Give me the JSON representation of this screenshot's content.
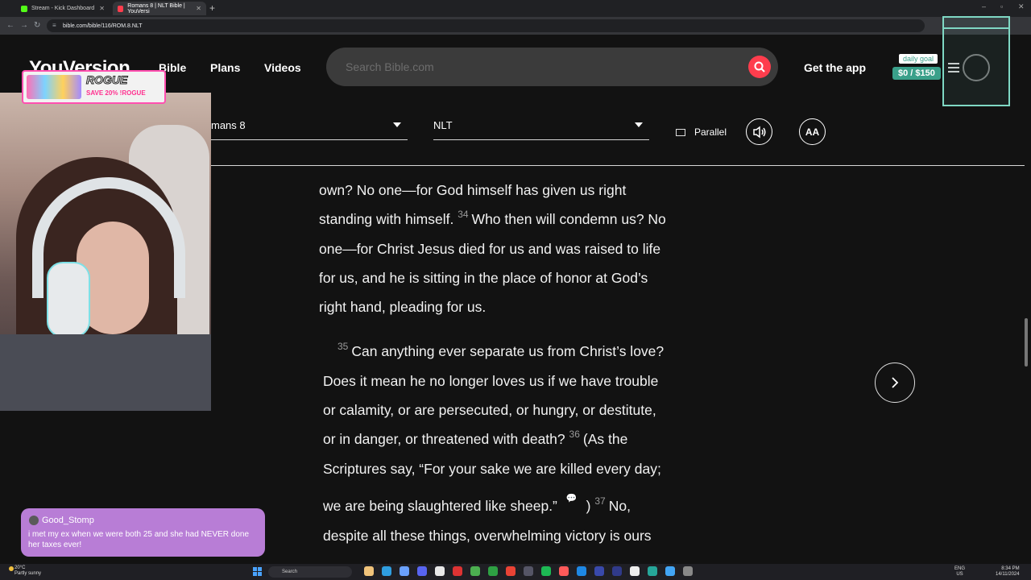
{
  "browser": {
    "tabs": [
      {
        "title": "Stream - Kick Dashboard",
        "color": "#53fc18"
      },
      {
        "title": "Romans 8 | NLT Bible | YouVersi",
        "color": "#ff3d4d"
      }
    ],
    "new_tab": "+",
    "url": "bible.com/bible/116/ROM.8.NLT"
  },
  "site": {
    "logo": "YouVersion",
    "nav": [
      "Bible",
      "Plans",
      "Videos"
    ],
    "search_placeholder": "Search Bible.com",
    "get_app": "Get the app",
    "accent": "#ff3d4d"
  },
  "toolbar": {
    "book_chapter": "mans 8",
    "version": "NLT",
    "parallel": "Parallel",
    "font_button": "AA"
  },
  "scripture": {
    "lines": [
      {
        "text": "own? No one—for God himself has given us right"
      },
      {
        "pre": "standing with himself.",
        "num": "34",
        "post": "Who then will condemn us? No"
      },
      {
        "text": "one—for Christ Jesus died for us and was raised to life"
      },
      {
        "text": "for us, and he is sitting in the place of honor at God’s"
      },
      {
        "text": "right hand, pleading for us."
      },
      {
        "num": "35",
        "post": "Can anything ever separate us from Christ’s love?"
      },
      {
        "text": "Does it mean he no longer loves us if we have trouble"
      },
      {
        "text": "or calamity, or are persecuted, or hungry, or destitute,"
      },
      {
        "pre": "or in danger, or threatened with death?",
        "num": "36",
        "post": "(As the"
      },
      {
        "text": "Scriptures say, “For your sake we are killed every day;"
      },
      {
        "pre": "we are being slaughtered like sheep.”",
        "mid": ")",
        "num": "37",
        "post": "No,"
      },
      {
        "text": "despite all these things, overwhelming victory is ours"
      }
    ]
  },
  "overlay": {
    "sponsor_title": "ROGUE",
    "sponsor_promo": "SAVE 20% !ROGUE",
    "goal_label": "daily goal",
    "goal_value": "$0 / $150",
    "chat_user": "Good_Stomp",
    "chat_message": "i met my ex when we were both 25 and she had NEVER done her taxes ever!"
  },
  "taskbar": {
    "weather_temp": "20°C",
    "weather_desc": "Partly sunny",
    "search": "Search",
    "lang1": "ENG",
    "lang2": "US",
    "time": "8:34 PM",
    "date": "14/11/2024"
  }
}
